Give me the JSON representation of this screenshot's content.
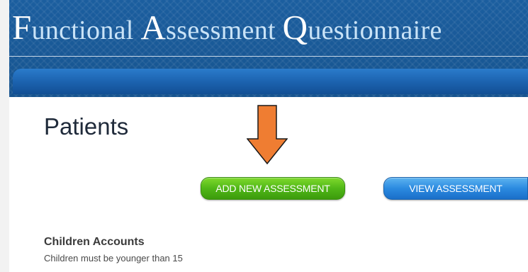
{
  "header": {
    "title_parts": [
      {
        "cap": "F",
        "rest": "unctional "
      },
      {
        "cap": "A",
        "rest": "ssessment "
      },
      {
        "cap": "Q",
        "rest": "uestionnaire"
      }
    ]
  },
  "main": {
    "page_title": "Patients",
    "add_button_label": "ADD NEW ASSESSMENT",
    "view_button_label": "VIEW ASSESSMENT",
    "section_title": "Children Accounts",
    "section_subtitle": "Children must be younger than 15"
  },
  "annotation": {
    "arrow_icon": "arrow-down-icon",
    "arrow_color": "#ef7d32"
  },
  "colors": {
    "header_blue": "#1a5c9e",
    "add_green": "#50b717",
    "view_blue": "#2b8ae0"
  }
}
